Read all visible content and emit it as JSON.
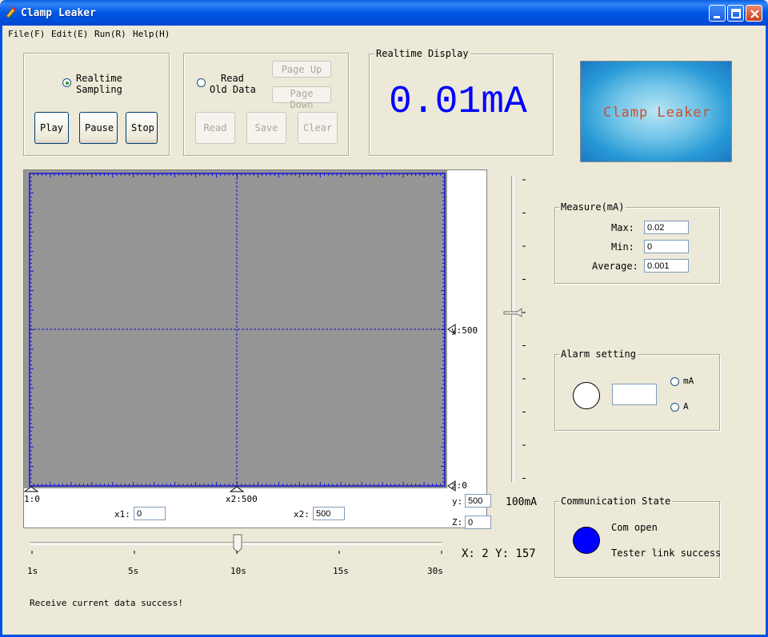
{
  "window": {
    "title": "Clamp Leaker"
  },
  "menu": [
    "File(F)",
    "Edit(E)",
    "Run(R)",
    "Help(H)"
  ],
  "realtime_group": {
    "radio_label_line1": "Realtime",
    "radio_label_line2": "Sampling",
    "play": "Play",
    "pause": "Pause",
    "stop": "Stop"
  },
  "old_data_group": {
    "radio_label_line1": "Read",
    "radio_label_line2": "Old Data",
    "page_up": "Page Up",
    "page_down": "Page Down",
    "read": "Read",
    "save": "Save",
    "clear": "Clear"
  },
  "display": {
    "legend": "Realtime Display",
    "value": "0.01mA"
  },
  "logo": {
    "text": "Clamp Leaker"
  },
  "plot": {
    "y_marker": "y:500",
    "z_marker": "z:0",
    "x1_marker": "1:0",
    "x2_marker": "x2:500",
    "x1_label": "x1:",
    "x1_value": "0",
    "x2_label": "x2:",
    "x2_value": "500",
    "y_label": "y:",
    "y_value": "500",
    "z_label": "Z:",
    "z_value": "0",
    "coord_readout": "X: 2 Y: 157"
  },
  "vslider": {
    "unit": "100mA"
  },
  "timescale": {
    "ticks": [
      "1s",
      "5s",
      "10s",
      "15s",
      "30s"
    ]
  },
  "measure": {
    "legend": "Measure(mA)",
    "max_label": "Max:",
    "max_value": "0.02",
    "min_label": "Min:",
    "min_value": "0",
    "avg_label": "Average:",
    "avg_value": "0.001"
  },
  "alarm": {
    "legend": "Alarm setting",
    "value": "",
    "unit_ma": "mA",
    "unit_a": "A"
  },
  "comm": {
    "legend": "Communication State",
    "line1": "Com open",
    "line2": "Tester link success",
    "led_color": "#0000ff"
  },
  "status": {
    "message": "Receive current data success!"
  },
  "colors": {
    "display_digits": "#0000ff",
    "plot_bg": "#969696",
    "grid": "#1010d0"
  }
}
